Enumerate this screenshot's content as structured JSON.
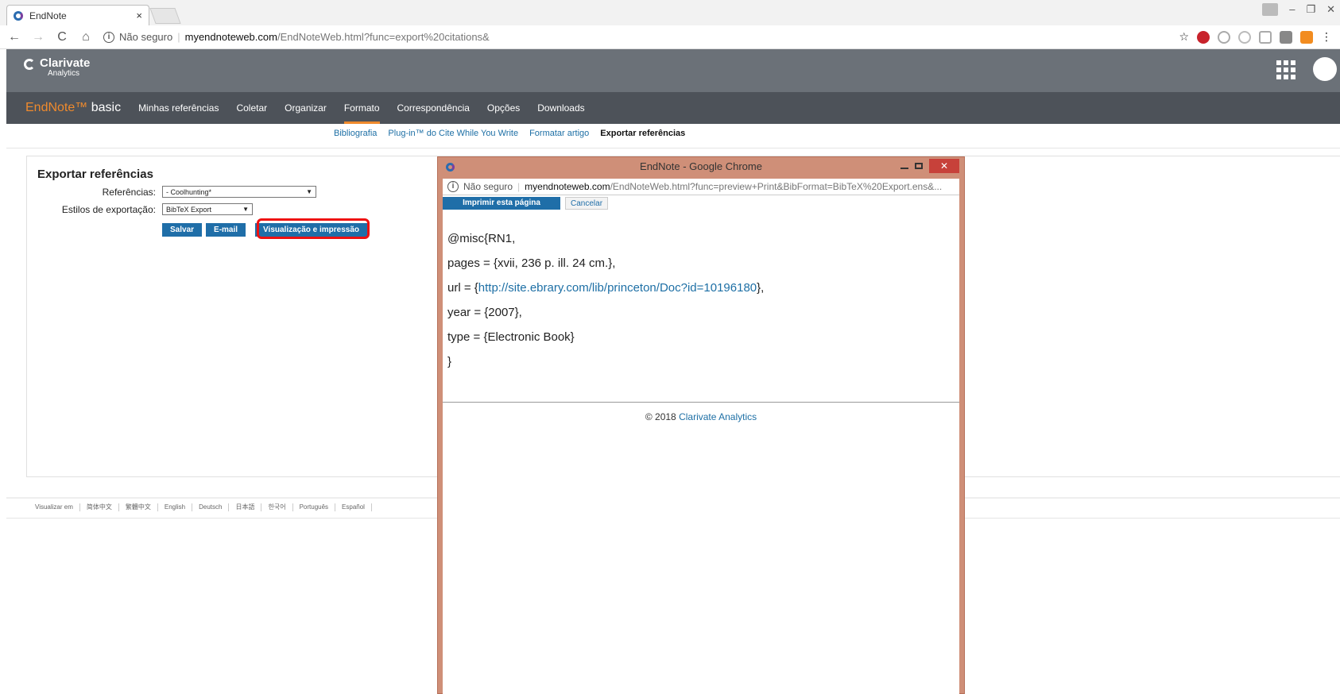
{
  "browser": {
    "tab_title": "EndNote",
    "tab_close": "×",
    "security_label": "Não seguro",
    "url_host": "myendnoteweb.com",
    "url_path": "/EndNoteWeb.html?func=export%20citations&",
    "back_icon": "←",
    "forward_icon": "→",
    "reload_icon": "C",
    "home_icon": "⌂",
    "star_icon": "☆",
    "menu_icon": "⋮"
  },
  "header": {
    "brand_name": "Clarivate",
    "brand_sub": "Analytics"
  },
  "endnote_nav": {
    "brand": "EndNote™",
    "brand_suffix": " basic",
    "items": [
      {
        "label": "Minhas referências"
      },
      {
        "label": "Coletar"
      },
      {
        "label": "Organizar"
      },
      {
        "label": "Formato"
      },
      {
        "label": "Correspondência"
      },
      {
        "label": "Opções"
      },
      {
        "label": "Downloads"
      }
    ],
    "active": "Formato"
  },
  "subnav": {
    "items": [
      "Bibliografia",
      "Plug-in™ do Cite While You Write",
      "Formatar artigo",
      "Exportar referências"
    ]
  },
  "export": {
    "title": "Exportar referências",
    "references_label": "Referências:",
    "references_value": "- Coolhunting*",
    "styles_label": "Estilos de exportação:",
    "styles_value": "BibTeX Export",
    "save_button": "Salvar",
    "email_button": "E-mail",
    "preview_button": "Visualização e impressão"
  },
  "footer": {
    "view_in": "Visualizar em",
    "languages": [
      "简体中文",
      "繁體中文",
      "English",
      "Deutsch",
      "日本語",
      "한국어",
      "Português",
      "Español"
    ]
  },
  "popup": {
    "title": "EndNote - Google Chrome",
    "close": "✕",
    "security_label": "Não seguro",
    "url_host": "myendnoteweb.com",
    "url_path": "/EndNoteWeb.html?func=preview+Print&BibFormat=BibTeX%20Export.ens&...",
    "print_button": "Imprimir esta página",
    "cancel_button": "Cancelar",
    "bibtex": {
      "line1": "@misc{RN1,",
      "line2": "pages = {xvii, 236 p. ill. 24 cm.},",
      "line3_prefix": "url = {",
      "line3_link": "http://site.ebrary.com/lib/princeton/Doc?id=10196180",
      "line3_suffix": "},",
      "line4": "year = {2007},",
      "line5": "type = {Electronic Book}",
      "line6": "}"
    },
    "copyright_prefix": "© 2018 ",
    "copyright_link": "Clarivate Analytics"
  },
  "colors": {
    "accent": "#ef8a2d",
    "button_blue": "#1f6ea8",
    "popup_frame": "#cf8f78",
    "highlight": "#e11111"
  }
}
